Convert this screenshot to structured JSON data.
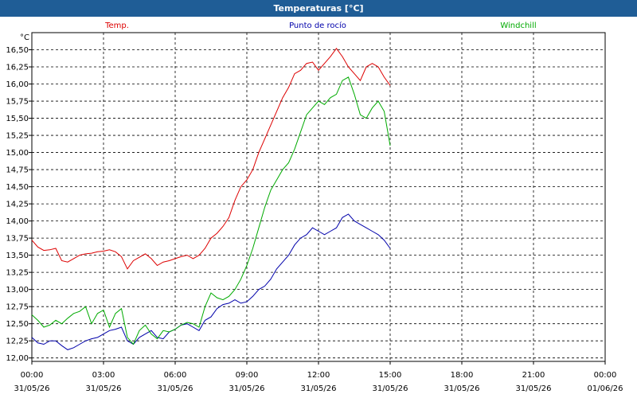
{
  "window": {
    "title": "Temperaturas [°C]"
  },
  "chart_data": {
    "type": "line",
    "title": "Temperaturas [°C]",
    "ylabel": "°C",
    "xlabel": "",
    "ylim": [
      11.95,
      16.75
    ],
    "y_ticks": [
      "12,00",
      "12,25",
      "12,50",
      "12,75",
      "13,00",
      "13,25",
      "13,50",
      "13,75",
      "14,00",
      "14,25",
      "14,50",
      "14,75",
      "15,00",
      "15,25",
      "15,50",
      "15,75",
      "16,00",
      "16,25",
      "16,50"
    ],
    "y_tick_values": [
      12.0,
      12.25,
      12.5,
      12.75,
      13.0,
      13.25,
      13.5,
      13.75,
      14.0,
      14.25,
      14.5,
      14.75,
      15.0,
      15.25,
      15.5,
      15.75,
      16.0,
      16.25,
      16.5
    ],
    "x_ticks": [
      {
        "hour": 0,
        "time": "00:00",
        "date": "31/05/26"
      },
      {
        "hour": 3,
        "time": "03:00",
        "date": "31/05/26"
      },
      {
        "hour": 6,
        "time": "06:00",
        "date": "31/05/26"
      },
      {
        "hour": 9,
        "time": "09:00",
        "date": "31/05/26"
      },
      {
        "hour": 12,
        "time": "12:00",
        "date": "31/05/26"
      },
      {
        "hour": 15,
        "time": "15:00",
        "date": "31/05/26"
      },
      {
        "hour": 18,
        "time": "18:00",
        "date": "31/05/26"
      },
      {
        "hour": 21,
        "time": "21:00",
        "date": "31/05/26"
      },
      {
        "hour": 24,
        "time": "00:00",
        "date": "01/06/26"
      }
    ],
    "grid": true,
    "legend_position": "top",
    "series": [
      {
        "name": "Temp.",
        "color": "#dd0000",
        "x": [
          0,
          0.25,
          0.5,
          0.75,
          1,
          1.25,
          1.5,
          1.75,
          2,
          2.25,
          2.5,
          2.75,
          3,
          3.25,
          3.5,
          3.75,
          4,
          4.25,
          4.5,
          4.75,
          5,
          5.25,
          5.5,
          5.75,
          6,
          6.25,
          6.5,
          6.75,
          7,
          7.25,
          7.5,
          7.75,
          8,
          8.25,
          8.5,
          8.75,
          9,
          9.25,
          9.5,
          9.75,
          10,
          10.25,
          10.5,
          10.75,
          11,
          11.25,
          11.5,
          11.75,
          12,
          12.25,
          12.5,
          12.75,
          13,
          13.25,
          13.5,
          13.75,
          14,
          14.25,
          14.5,
          14.75,
          15
        ],
        "y": [
          13.72,
          13.62,
          13.57,
          13.58,
          13.6,
          13.42,
          13.4,
          13.45,
          13.5,
          13.52,
          13.53,
          13.55,
          13.56,
          13.58,
          13.55,
          13.48,
          13.3,
          13.42,
          13.47,
          13.52,
          13.45,
          13.35,
          13.4,
          13.42,
          13.45,
          13.48,
          13.5,
          13.45,
          13.5,
          13.6,
          13.75,
          13.82,
          13.92,
          14.05,
          14.3,
          14.5,
          14.6,
          14.75,
          15.0,
          15.2,
          15.4,
          15.6,
          15.8,
          15.95,
          16.15,
          16.2,
          16.3,
          16.32,
          16.2,
          16.3,
          16.4,
          16.52,
          16.4,
          16.25,
          16.15,
          16.05,
          16.25,
          16.3,
          16.25,
          16.1,
          15.98
        ]
      },
      {
        "name": "Punto de rocío",
        "color": "#0000aa",
        "x": [
          0,
          0.25,
          0.5,
          0.75,
          1,
          1.25,
          1.5,
          1.75,
          2,
          2.25,
          2.5,
          2.75,
          3,
          3.25,
          3.5,
          3.75,
          4,
          4.25,
          4.5,
          4.75,
          5,
          5.25,
          5.5,
          5.75,
          6,
          6.25,
          6.5,
          6.75,
          7,
          7.25,
          7.5,
          7.75,
          8,
          8.25,
          8.5,
          8.75,
          9,
          9.25,
          9.5,
          9.75,
          10,
          10.25,
          10.5,
          10.75,
          11,
          11.25,
          11.5,
          11.75,
          12,
          12.25,
          12.5,
          12.75,
          13,
          13.25,
          13.5,
          13.75,
          14,
          14.25,
          14.5,
          14.75,
          15
        ],
        "y": [
          12.3,
          12.22,
          12.2,
          12.25,
          12.25,
          12.18,
          12.12,
          12.15,
          12.2,
          12.25,
          12.28,
          12.3,
          12.35,
          12.4,
          12.42,
          12.45,
          12.25,
          12.2,
          12.3,
          12.35,
          12.4,
          12.3,
          12.28,
          12.38,
          12.42,
          12.48,
          12.5,
          12.45,
          12.4,
          12.55,
          12.6,
          12.72,
          12.78,
          12.8,
          12.85,
          12.8,
          12.82,
          12.9,
          13.0,
          13.05,
          13.15,
          13.3,
          13.4,
          13.5,
          13.65,
          13.75,
          13.8,
          13.9,
          13.85,
          13.8,
          13.85,
          13.9,
          14.05,
          14.1,
          14.0,
          13.95,
          13.9,
          13.85,
          13.8,
          13.72,
          13.6
        ]
      },
      {
        "name": "Windchill",
        "color": "#00aa00",
        "x": [
          0,
          0.25,
          0.5,
          0.75,
          1,
          1.25,
          1.5,
          1.75,
          2,
          2.25,
          2.5,
          2.75,
          3,
          3.25,
          3.5,
          3.75,
          4,
          4.25,
          4.5,
          4.75,
          5,
          5.25,
          5.5,
          5.75,
          6,
          6.25,
          6.5,
          6.75,
          7,
          7.25,
          7.5,
          7.75,
          8,
          8.25,
          8.5,
          8.75,
          9,
          9.25,
          9.5,
          9.75,
          10,
          10.25,
          10.5,
          10.75,
          11,
          11.25,
          11.5,
          11.75,
          12,
          12.25,
          12.5,
          12.75,
          13,
          13.25,
          13.5,
          13.75,
          14,
          14.25,
          14.5,
          14.75,
          15
        ],
        "y": [
          12.63,
          12.55,
          12.45,
          12.48,
          12.55,
          12.5,
          12.58,
          12.65,
          12.68,
          12.75,
          12.5,
          12.65,
          12.7,
          12.45,
          12.65,
          12.72,
          12.3,
          12.2,
          12.4,
          12.48,
          12.35,
          12.28,
          12.4,
          12.38,
          12.42,
          12.48,
          12.52,
          12.5,
          12.45,
          12.75,
          12.95,
          12.88,
          12.85,
          12.9,
          13.0,
          13.15,
          13.35,
          13.6,
          13.9,
          14.2,
          14.45,
          14.6,
          14.75,
          14.85,
          15.05,
          15.3,
          15.55,
          15.65,
          15.75,
          15.7,
          15.8,
          15.85,
          16.05,
          16.1,
          15.85,
          15.55,
          15.5,
          15.65,
          15.75,
          15.6,
          15.1
        ]
      }
    ]
  }
}
